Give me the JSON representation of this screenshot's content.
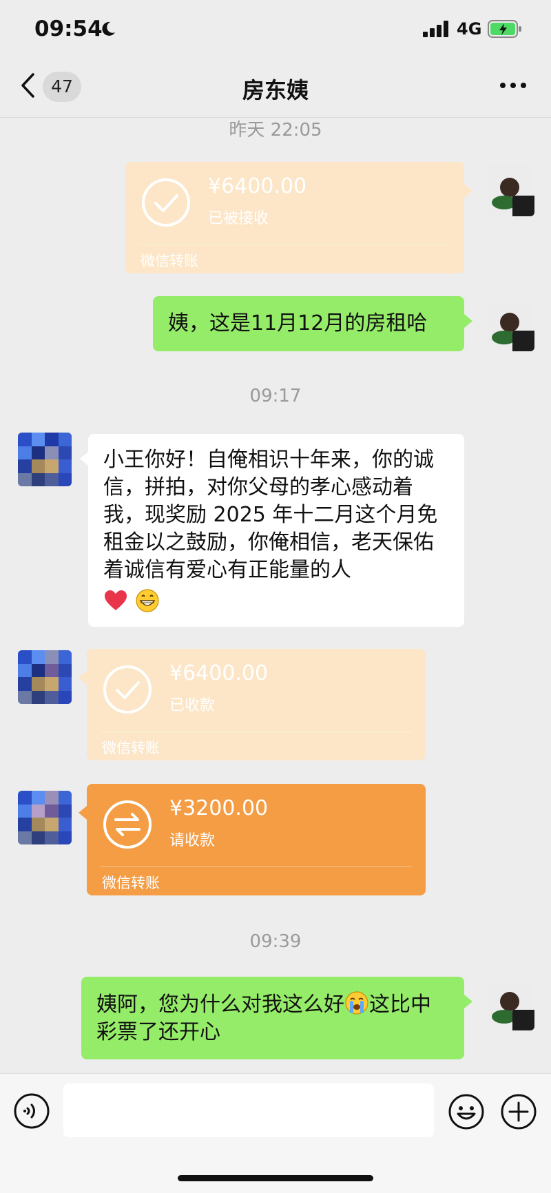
{
  "status_bar": {
    "time": "09:54",
    "network": "4G"
  },
  "nav": {
    "back_badge": "47",
    "title": "房东姨"
  },
  "timestamps": {
    "t1": "昨天 22:05",
    "t2": "09:17",
    "t3": "09:39"
  },
  "messages": {
    "m1_transfer": {
      "amount": "¥6400.00",
      "status": "已被接收",
      "caption": "微信转账"
    },
    "m2_text": "姨，这是11月12月的房租哈",
    "m3_text": "小王你好！自俺相识十年来，你的诚信，拼拍，对你父母的孝心感动着我，现奖励 2025 年十二月这个月免租金以之鼓励，你俺相信，老天保佑着诚信有爱心有正能量的人",
    "m4_transfer": {
      "amount": "¥6400.00",
      "status": "已收款",
      "caption": "微信转账"
    },
    "m5_transfer": {
      "amount": "¥3200.00",
      "status": "请收款",
      "caption": "微信转账"
    },
    "m6_text_a": "姨阿，您为什么对我这么好",
    "m6_text_b": "这比中彩票了还开心"
  },
  "input": {
    "placeholder": ""
  },
  "icons": {
    "back": "chevron-left-icon",
    "more": "more-dots-icon",
    "received": "check-circle-icon",
    "pending": "transfer-arrows-icon",
    "voice": "voice-icon",
    "emoji": "emoji-icon",
    "plus": "plus-circle-icon"
  },
  "colors": {
    "bubble_mine": "#95ec69",
    "transfer_received": "#fce6c7",
    "transfer_pending": "#f49d45",
    "background": "#ededed"
  }
}
